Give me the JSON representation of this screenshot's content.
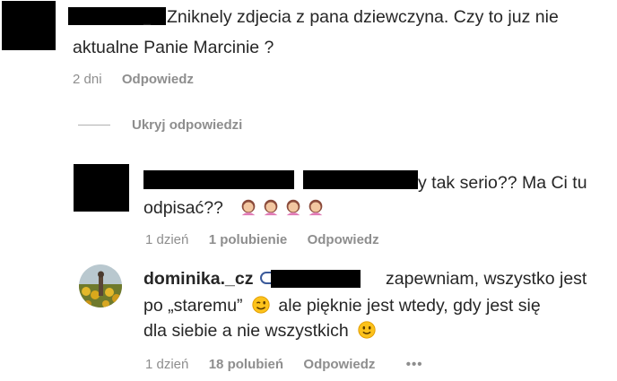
{
  "comment1": {
    "username_tail": "_",
    "text_line1": "Zniknely zdjecia z pana dziewczyna. Czy to juz nie",
    "text_line2": "aktualne Panie Marcinie ?",
    "time": "2 dni",
    "reply_label": "Odpowiedz"
  },
  "hide_replies_label": "Ukryj odpowiedzi",
  "reply1": {
    "text_line1_tail": "y tak serio?? Ma Ci tu",
    "text_line2": "odpisać??",
    "emojis": [
      "woman-facepalming-icon",
      "woman-facepalming-icon",
      "woman-facepalming-icon",
      "woman-facepalming-icon"
    ],
    "time": "1 dzień",
    "likes": "1 polubienie",
    "reply_label": "Odpowiedz"
  },
  "reply2": {
    "username": "dominika._cz",
    "text_line1_tail": "zapewniam, wszystko jest",
    "text_line2_a": "po „staremu”",
    "text_line2_b": "ale pięknie jest wtedy, gdy jest się",
    "text_line3": "dla siebie a nie wszystkich",
    "emoji_wink": "winking-face-icon",
    "emoji_smile": "slightly-smiling-face-icon",
    "time": "1 dzień",
    "likes": "18 polubień",
    "reply_label": "Odpowiedz",
    "more_label": "•••"
  }
}
